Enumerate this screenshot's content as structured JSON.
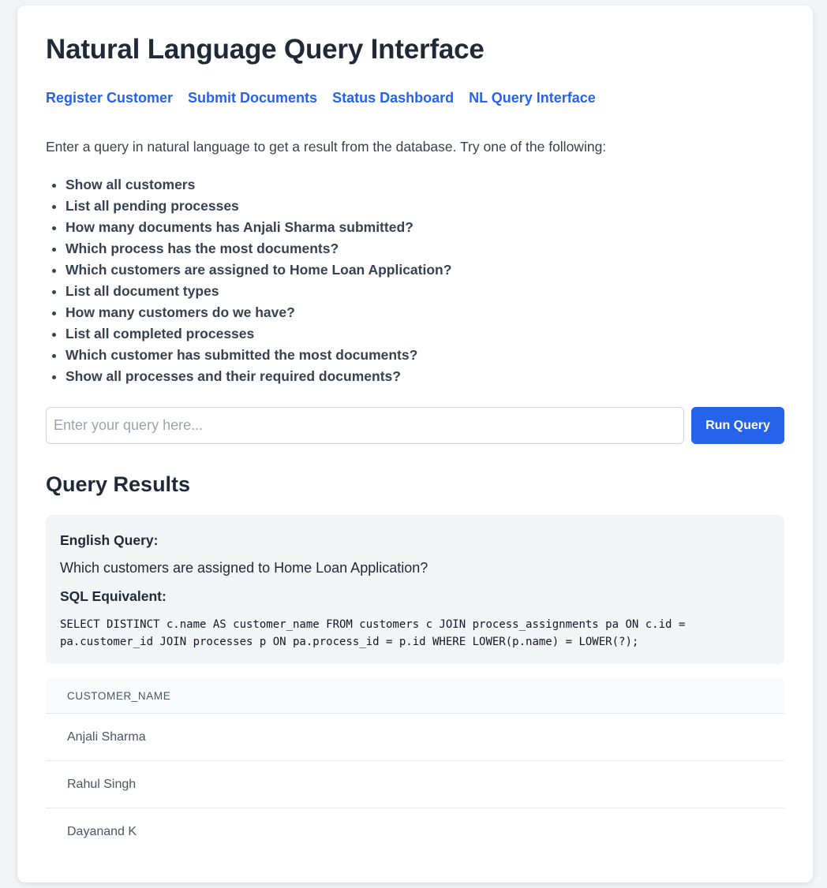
{
  "page": {
    "title": "Natural Language Query Interface"
  },
  "nav": {
    "links": [
      "Register Customer",
      "Submit Documents",
      "Status Dashboard",
      "NL Query Interface"
    ]
  },
  "intro": "Enter a query in natural language to get a result from the database. Try one of the following:",
  "examples": [
    "Show all customers",
    "List all pending processes",
    "How many documents has Anjali Sharma submitted?",
    "Which process has the most documents?",
    "Which customers are assigned to Home Loan Application?",
    "List all document types",
    "How many customers do we have?",
    "List all completed processes",
    "Which customer has submitted the most documents?",
    "Show all processes and their required documents?"
  ],
  "query": {
    "placeholder": "Enter your query here...",
    "value": "",
    "button_label": "Run Query"
  },
  "results": {
    "heading": "Query Results",
    "english_label": "English Query:",
    "english_text": "Which customers are assigned to Home Loan Application?",
    "sql_label": "SQL Equivalent:",
    "sql_text": "SELECT DISTINCT c.name AS customer_name FROM customers c JOIN process_assignments pa ON c.id = pa.customer_id JOIN processes p ON pa.process_id = p.id WHERE LOWER(p.name) = LOWER(?);"
  },
  "table": {
    "columns": [
      "customer_name"
    ],
    "rows": [
      [
        "Anjali Sharma"
      ],
      [
        "Rahul Singh"
      ],
      [
        "Dayanand K"
      ]
    ]
  },
  "colors": {
    "accent": "#2563eb",
    "background": "#f3f4f6",
    "card": "#ffffff"
  }
}
